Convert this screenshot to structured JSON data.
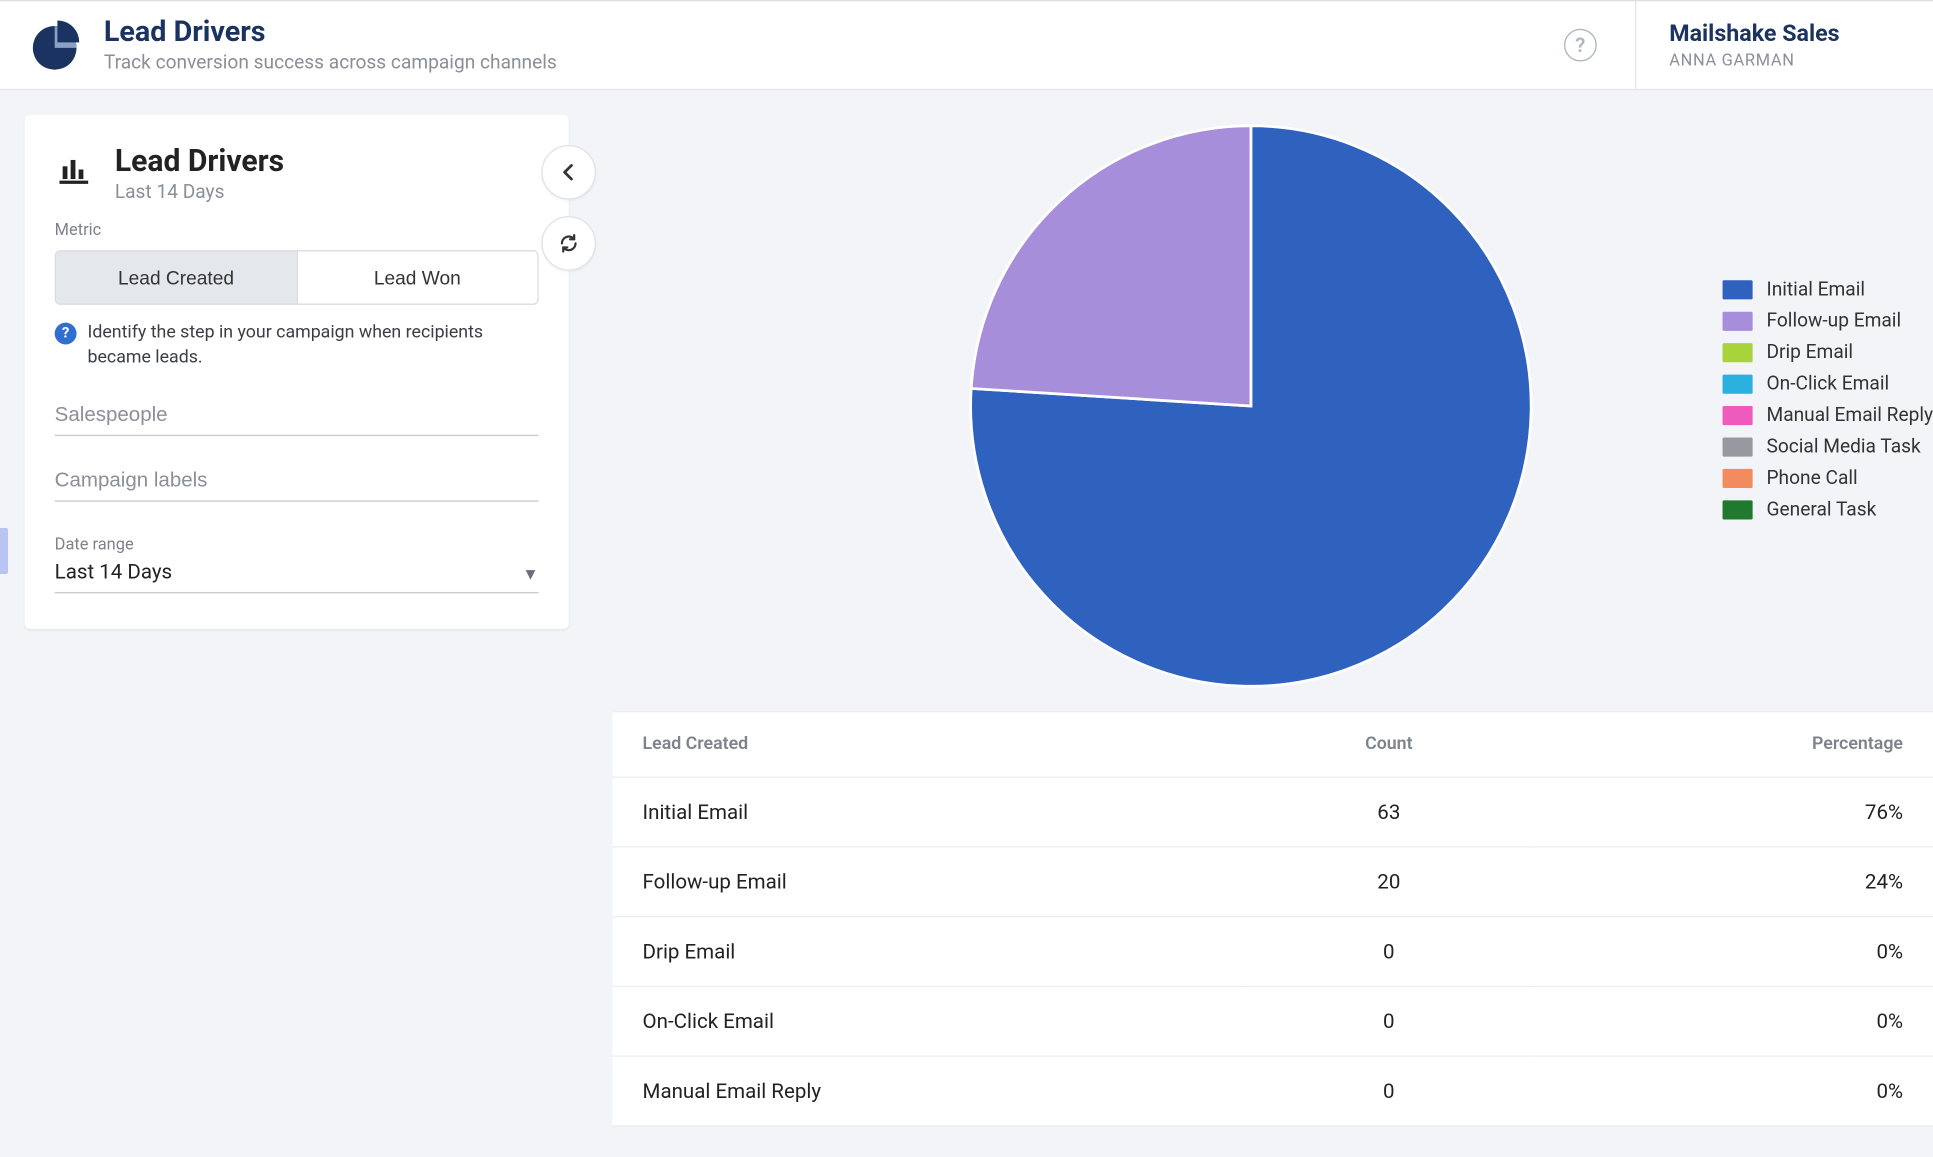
{
  "header": {
    "title": "Lead Drivers",
    "subtitle": "Track conversion success across campaign channels",
    "org": "Mailshake Sales",
    "user": "ANNA GARMAN"
  },
  "panel": {
    "title": "Lead Drivers",
    "range_text": "Last 14 Days",
    "metric_label": "Metric",
    "segments": {
      "lead_created": "Lead Created",
      "lead_won": "Lead Won"
    },
    "hint": "Identify the step in your campaign when recipients became leads.",
    "salespeople_placeholder": "Salespeople",
    "campaign_labels_placeholder": "Campaign labels",
    "date_range_label": "Date range",
    "date_range_value": "Last 14 Days"
  },
  "legend": [
    {
      "label": "Initial Email",
      "color": "#2f62bf"
    },
    {
      "label": "Follow-up Email",
      "color": "#a78edb"
    },
    {
      "label": "Drip Email",
      "color": "#a8d33a"
    },
    {
      "label": "On-Click Email",
      "color": "#2bb0e0"
    },
    {
      "label": "Manual Email Reply",
      "color": "#ef5bbd"
    },
    {
      "label": "Social Media Task",
      "color": "#969aa0"
    },
    {
      "label": "Phone Call",
      "color": "#f28c5e"
    },
    {
      "label": "General Task",
      "color": "#1f7a2e"
    }
  ],
  "table": {
    "headers": {
      "c1": "Lead Created",
      "c2": "Count",
      "c3": "Percentage"
    },
    "rows": [
      {
        "label": "Initial Email",
        "count": "63",
        "pct": "76%"
      },
      {
        "label": "Follow-up Email",
        "count": "20",
        "pct": "24%"
      },
      {
        "label": "Drip Email",
        "count": "0",
        "pct": "0%"
      },
      {
        "label": "On-Click Email",
        "count": "0",
        "pct": "0%"
      },
      {
        "label": "Manual Email Reply",
        "count": "0",
        "pct": "0%"
      }
    ]
  },
  "chart_data": {
    "type": "pie",
    "title": "Lead Drivers — Lead Created (Last 14 Days)",
    "series": [
      {
        "name": "Initial Email",
        "value": 63,
        "percentage": 76,
        "color": "#2f62bf"
      },
      {
        "name": "Follow-up Email",
        "value": 20,
        "percentage": 24,
        "color": "#a78edb"
      },
      {
        "name": "Drip Email",
        "value": 0,
        "percentage": 0,
        "color": "#a8d33a"
      },
      {
        "name": "On-Click Email",
        "value": 0,
        "percentage": 0,
        "color": "#2bb0e0"
      },
      {
        "name": "Manual Email Reply",
        "value": 0,
        "percentage": 0,
        "color": "#ef5bbd"
      },
      {
        "name": "Social Media Task",
        "value": 0,
        "percentage": 0,
        "color": "#969aa0"
      },
      {
        "name": "Phone Call",
        "value": 0,
        "percentage": 0,
        "color": "#f28c5e"
      },
      {
        "name": "General Task",
        "value": 0,
        "percentage": 0,
        "color": "#1f7a2e"
      }
    ]
  }
}
